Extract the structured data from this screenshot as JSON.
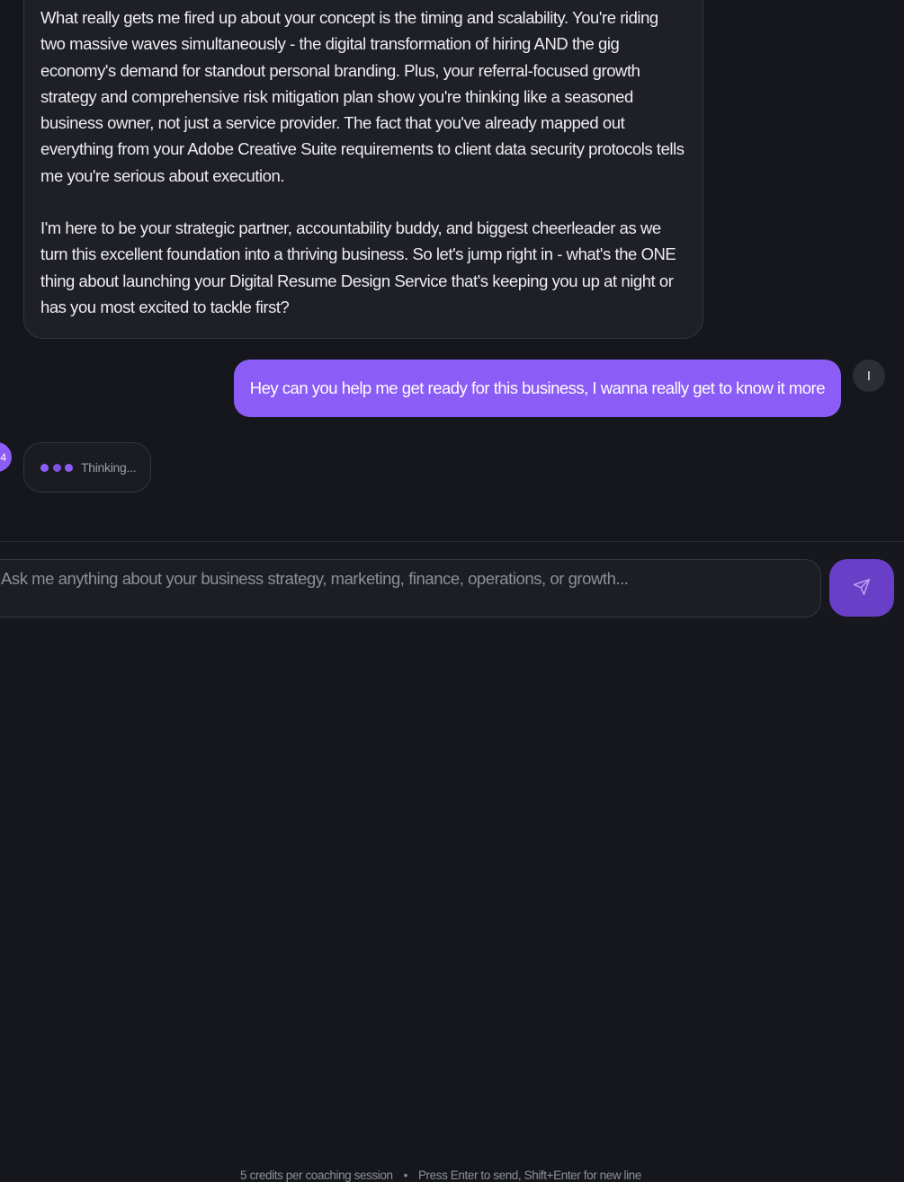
{
  "conversation": {
    "ai_message": {
      "paragraphs": [
        "What really gets me fired up about your concept is the timing and scalability. You're riding two massive waves simultaneously - the digital transformation of hiring AND the gig economy's demand for standout personal branding. Plus, your referral-focused growth strategy and comprehensive risk mitigation plan show you're thinking like a seasoned business owner, not just a service provider. The fact that you've already mapped out everything from your Adobe Creative Suite requirements to client data security protocols tells me you're serious about execution.",
        "I'm here to be your strategic partner, accountability buddy, and biggest cheerleader as we turn this excellent foundation into a thriving business. So let's jump right in - what's the ONE thing about launching your Digital Resume Design Service that's keeping you up at night or has you most excited to tackle first?"
      ]
    },
    "user_message": {
      "text": "Hey can you help me get ready for this business, I wanna really get to know it more",
      "avatar_initial": "I"
    },
    "ai_avatar_initial": "4",
    "thinking": {
      "label": "Thinking..."
    }
  },
  "composer": {
    "placeholder": "Ask me anything about your business strategy, marketing, finance, operations, or growth...",
    "value": "",
    "send_icon": "send-icon"
  },
  "footer": {
    "credits_text": "5 credits per coaching session",
    "separator": "•",
    "hint_text": "Press Enter to send, Shift+Enter for new line"
  },
  "colors": {
    "accent": "#8b5cf6",
    "send_button": "#6a3fc8",
    "background": "#15171c",
    "bubble": "#1e2026"
  }
}
